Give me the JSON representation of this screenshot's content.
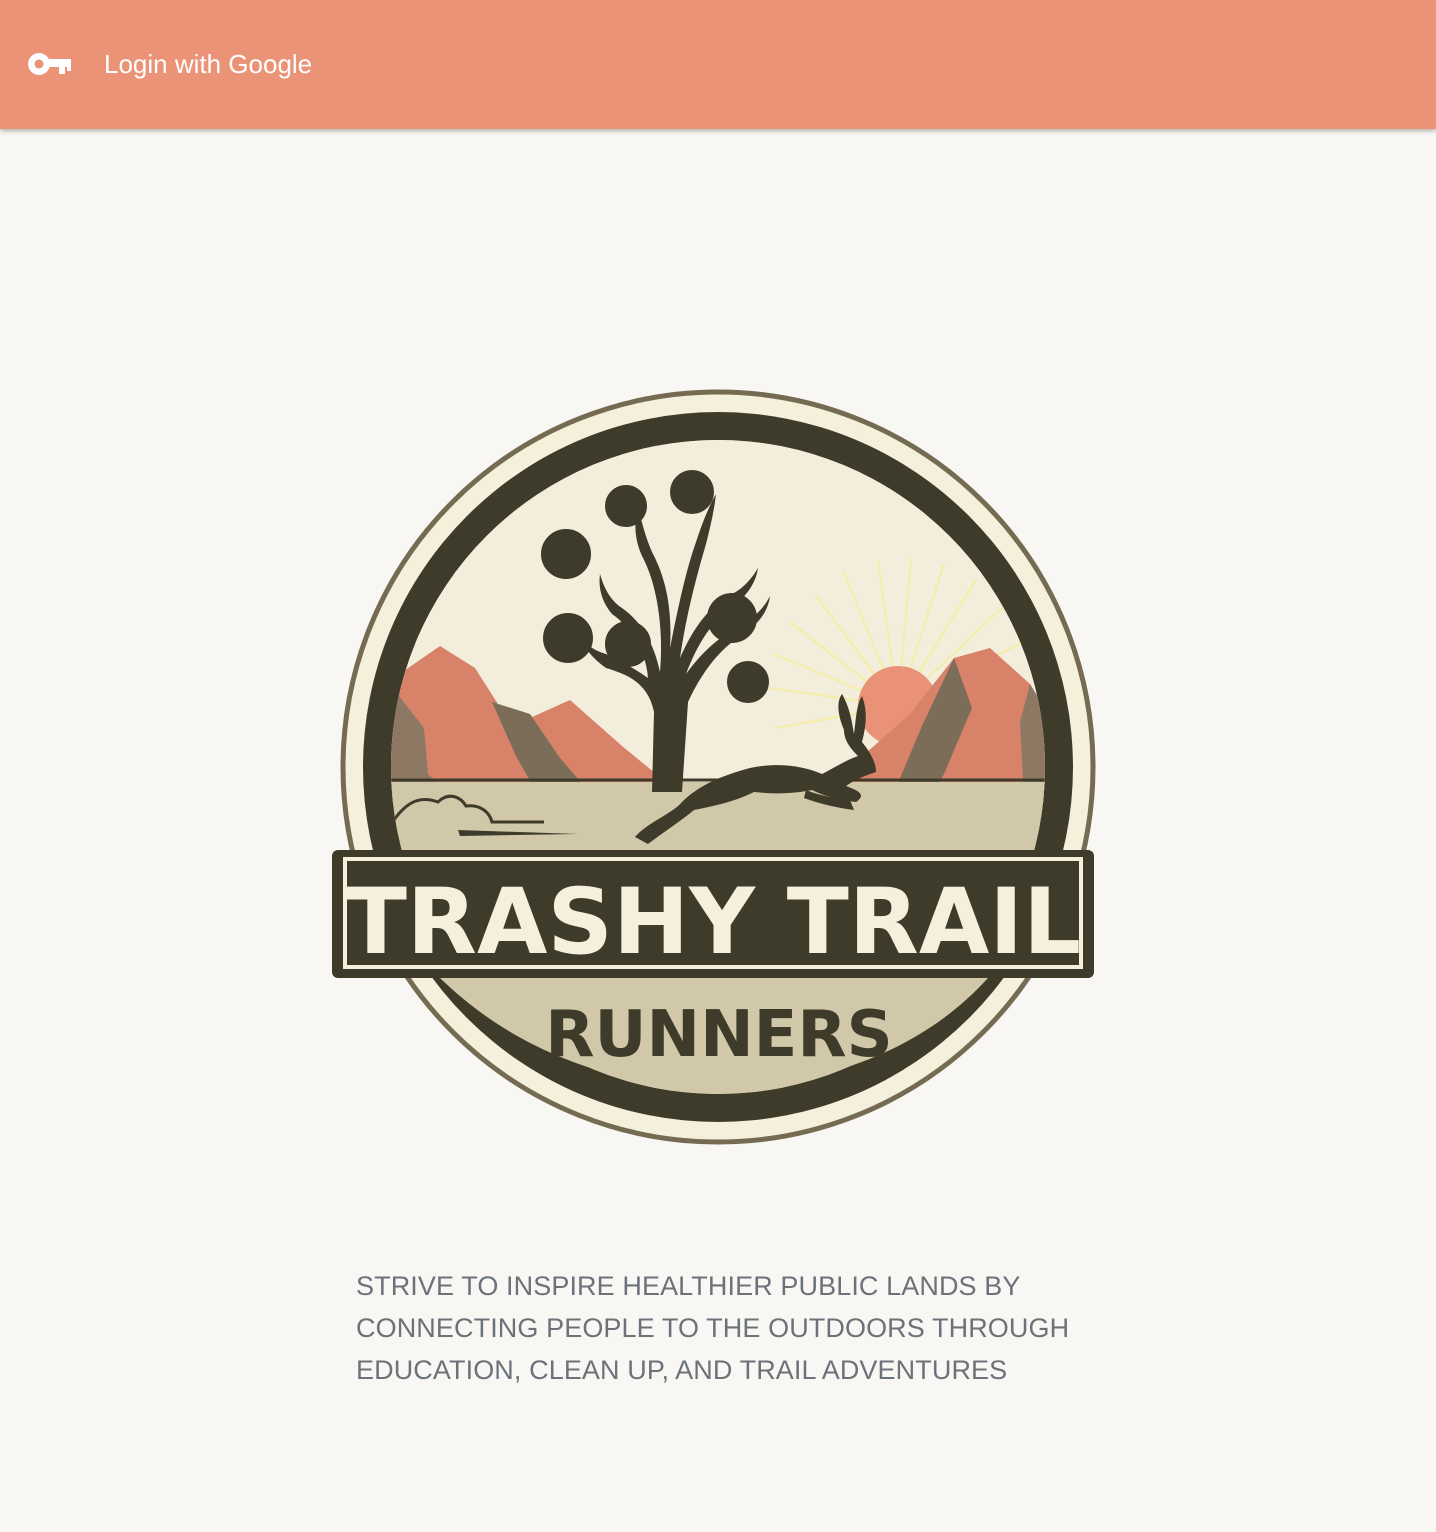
{
  "colors": {
    "header_bg": "#ea9376",
    "page_bg": "#f8f7f3",
    "mission_text": "#6c727a",
    "logo_dark": "#3f3b2b",
    "logo_cream": "#f4f0dc",
    "logo_sand": "#d0c8a8",
    "logo_rock": "#d9826a",
    "logo_sun": "#f0e59a"
  },
  "header": {
    "login_icon": "key-icon",
    "login_label": "Login with Google"
  },
  "logo": {
    "title": "TRASHY TRAIL",
    "subtitle": "RUNNERS"
  },
  "mission": {
    "lines": [
      "STRIVE TO INSPIRE HEALTHIER PUBLIC LANDS BY",
      "CONNECTING PEOPLE TO THE OUTDOORS THROUGH",
      "EDUCATION, CLEAN UP, AND TRAIL ADVENTURES"
    ]
  }
}
